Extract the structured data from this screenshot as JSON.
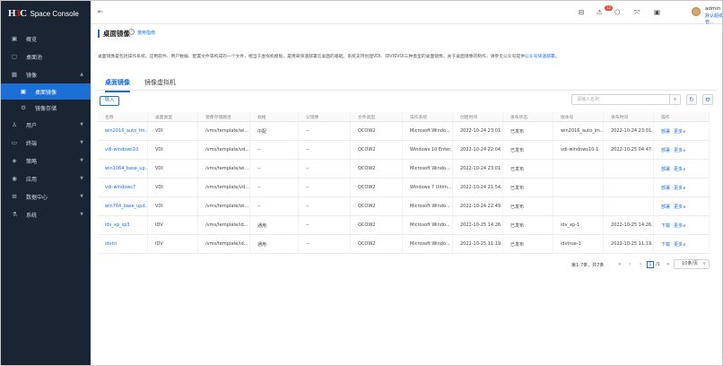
{
  "brand": {
    "prefix": "H",
    "accent": "3",
    "suffix": "C",
    "product": "Space Console"
  },
  "sidebar": {
    "items": [
      {
        "id": "overview",
        "icon": "▣",
        "label": "概览",
        "chevron": ""
      },
      {
        "id": "desktop-pool",
        "icon": "▢",
        "label": "桌面池",
        "chevron": ""
      },
      {
        "id": "image",
        "icon": "▦",
        "label": "镜像",
        "chevron": "▲"
      },
      {
        "id": "desktop-image",
        "icon": "▣",
        "label": "桌面镜像",
        "chevron": "",
        "sub": true,
        "active": true
      },
      {
        "id": "image-storage",
        "icon": "⚙",
        "label": "镜像存储",
        "chevron": "",
        "sub": true
      },
      {
        "id": "users",
        "icon": "♙",
        "label": "用户",
        "chevron": "▼"
      },
      {
        "id": "terminal",
        "icon": "▭",
        "label": "终端",
        "chevron": "▼"
      },
      {
        "id": "policy",
        "icon": "◈",
        "label": "策略",
        "chevron": "▼"
      },
      {
        "id": "app",
        "icon": "◉",
        "label": "应用",
        "chevron": "▼"
      },
      {
        "id": "datacenter",
        "icon": "⊞",
        "label": "数据中心",
        "chevron": "▼"
      },
      {
        "id": "system",
        "icon": "⚗",
        "label": "系统",
        "chevron": "▼"
      }
    ]
  },
  "topbar": {
    "collapse_icon": "⇤",
    "icons": [
      "⊟",
      "⚠",
      "⬡",
      "⤧",
      "▣"
    ],
    "badge": "12",
    "user_name": "admin",
    "user_role": "默认超级管..."
  },
  "page": {
    "title": "桌面镜像",
    "help": "?",
    "guide_link": "使用指南"
  },
  "description": {
    "text": "桌面镜像是包括操作系统、应用软件、用户数据、配置文件等构成的一个文件，相当于虚拟机模板，是用来快速部署云桌面的基础。系统支持创建VDI、IDV和VOI三种类型的桌面镜像。关于桌面镜像的制作，请参见公众号提供",
    "link": "公众号快速部署"
  },
  "tabs": [
    {
      "label": "桌面镜像",
      "active": true
    },
    {
      "label": "镜像虚拟机",
      "active": false
    }
  ],
  "toolbar": {
    "import_label": "导入",
    "search_placeholder": "请输入名称",
    "search_icon": "⌕",
    "refresh_icon": "↻",
    "settings_icon": "⚙"
  },
  "table": {
    "columns": [
      "名称",
      "桌面类型",
      "镜像存储路径",
      "规格",
      "父镜像",
      "文件类型",
      "操作系统",
      "创建时间",
      "发布状态",
      "版本号",
      "发布时间",
      "操作"
    ],
    "rows": [
      [
        "win2016_auto_tm...",
        "VDI",
        "/vms/template/wi...",
        "中配",
        "--",
        "QCOW2",
        "Microsoft Windo...",
        "2022-10-24 23:01...",
        "已发布",
        "win2016_auto_im...",
        "2022-10-24 23:01...",
        "部署",
        "更多∨"
      ],
      [
        "vdi-windows10",
        "VDI",
        "/vms/template/vd...",
        "--",
        "--",
        "QCOW2",
        "Windows 10 Enter...",
        "2022-10-24 22:04...",
        "已发布",
        "vdi-windows10-1",
        "2022-10-25 04:47...",
        "部署",
        "更多∨"
      ],
      [
        "win1064_base_up...",
        "VDI",
        "/vms/template/wi...",
        "--",
        "--",
        "QCOW2",
        "Microsoft Windo...",
        "2022-10-24 23:01...",
        "已发布",
        "",
        "",
        "部署",
        "更多∨"
      ],
      [
        "vdi-windows7",
        "VDI",
        "/vms/template/vd...",
        "--",
        "--",
        "QCOW2",
        "Windows 7 Ultim...",
        "2022-10-24 21:54...",
        "已发布",
        "",
        "",
        "部署",
        "更多∨"
      ],
      [
        "win764_base_upd...",
        "VDI",
        "/vms/template/wi...",
        "--",
        "--",
        "QCOW2",
        "Microsoft Windo...",
        "2022-10-24 22:49...",
        "已发布",
        "",
        "",
        "部署",
        "更多∨"
      ],
      [
        "idv_xp_sp3",
        "IDV",
        "/vms/template/id...",
        "通用",
        "--",
        "QCOW2",
        "Microsoft Windo...",
        "2022-10-25 14:26...",
        "已发布",
        "idv_xp-1",
        "2022-10-25 14:26...",
        "下载",
        "更多∨"
      ],
      [
        "idvtri",
        "IDV",
        "/vms/template/id...",
        "通用",
        "--",
        "QCOW2",
        "Microsoft Windo...",
        "2022-10-25 11:19...",
        "已发布",
        "idvtrue-1",
        "2022-10-25 11:19...",
        "下载",
        "更多∨"
      ]
    ]
  },
  "pagination": {
    "total": "第1-7条，共7条",
    "first": "«",
    "prev": "‹",
    "current": "1",
    "of": "/1",
    "next": "›",
    "last": "»",
    "page_size": "10条/页",
    "caret": "∨"
  }
}
